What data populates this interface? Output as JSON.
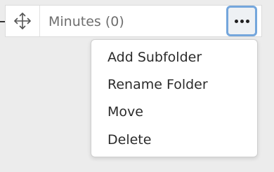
{
  "folder": {
    "name": "Minutes (0)",
    "drag_icon": "move-arrows-icon",
    "more_icon": "more-horizontal-icon"
  },
  "menu": {
    "items": [
      {
        "label": "Add Subfolder"
      },
      {
        "label": "Rename Folder"
      },
      {
        "label": "Move"
      },
      {
        "label": "Delete"
      }
    ]
  },
  "colors": {
    "background": "#ececec",
    "focus_ring": "#74a6dc",
    "label_text": "#6e6e6e",
    "menu_text": "#2b2b2b"
  }
}
